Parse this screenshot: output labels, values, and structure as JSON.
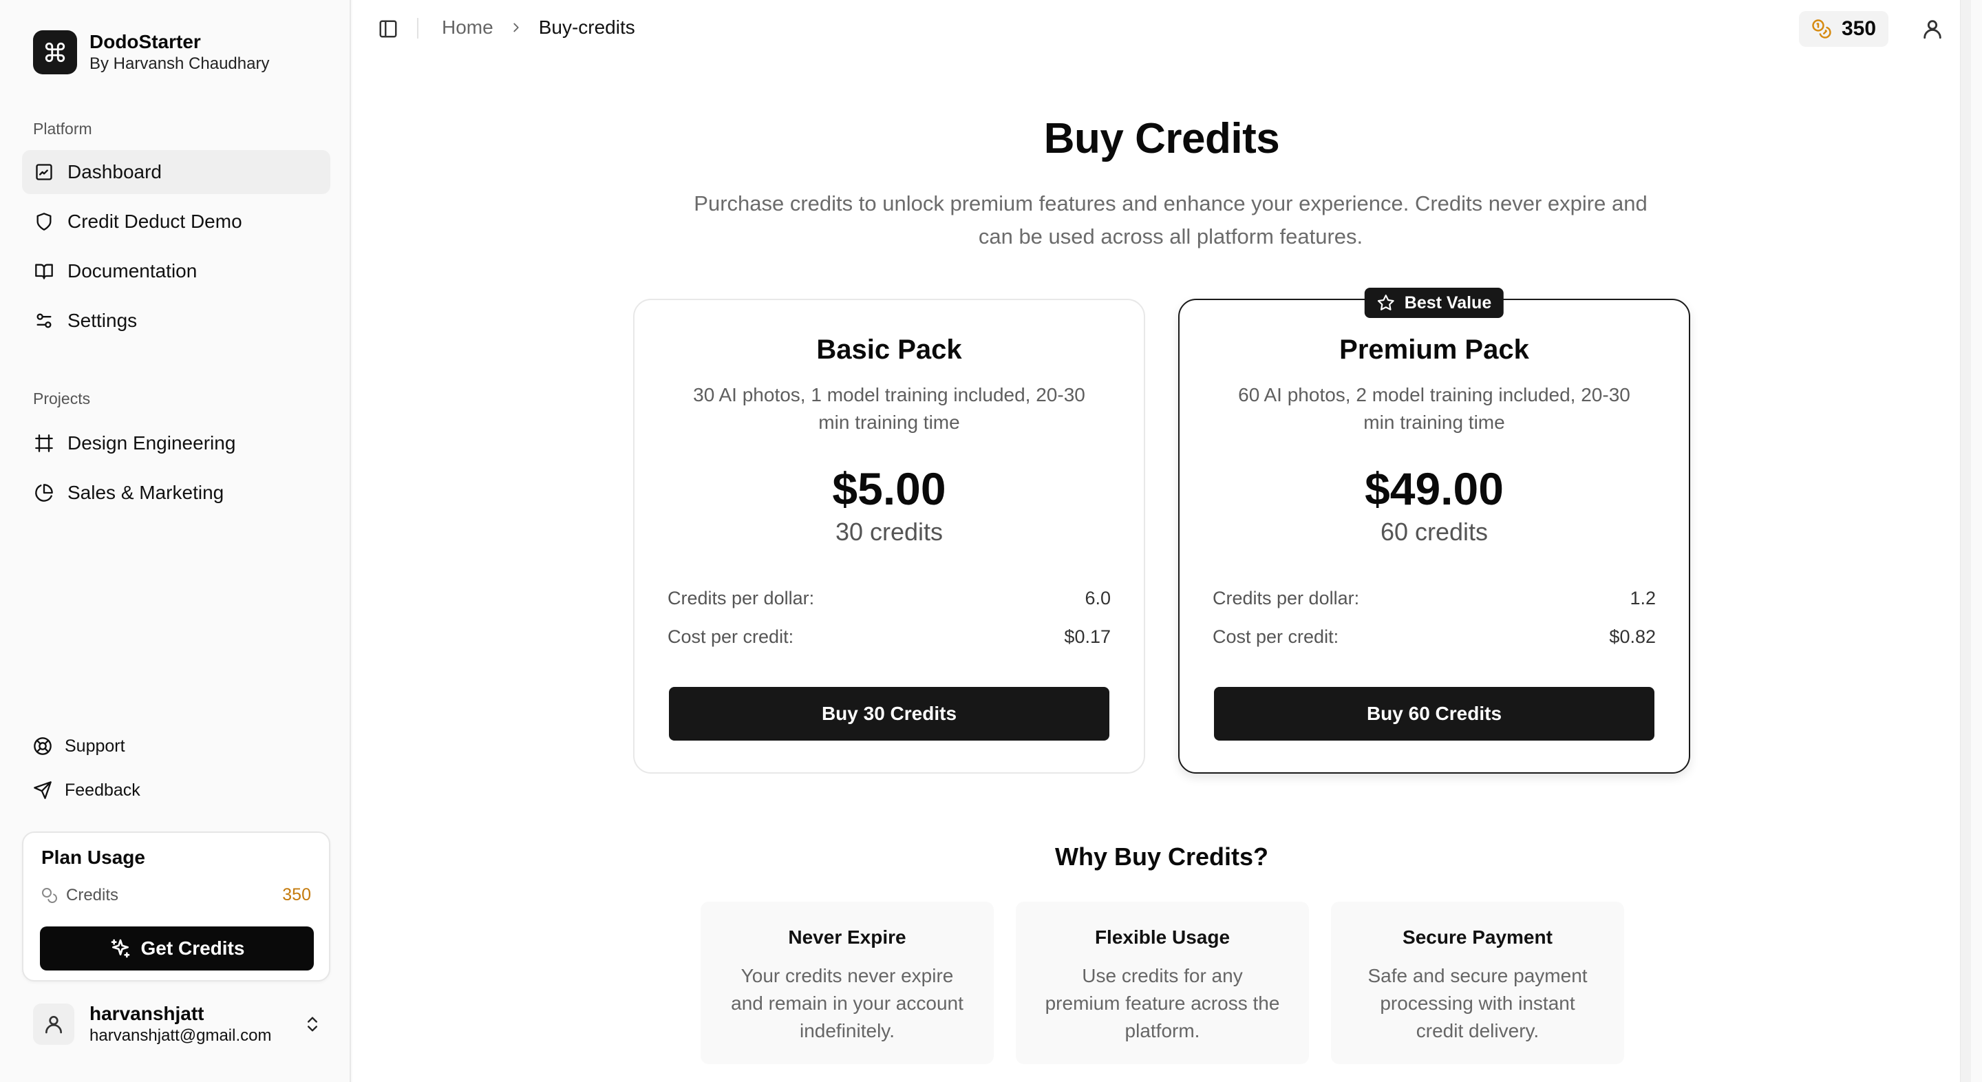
{
  "brand": {
    "name": "DodoStarter",
    "subtitle": "By Harvansh Chaudhary",
    "logo_icon": "command-icon"
  },
  "sidebar": {
    "platform_label": "Platform",
    "platform_items": [
      {
        "label": "Dashboard",
        "icon": "dashboard-icon",
        "active": true
      },
      {
        "label": "Credit Deduct Demo",
        "icon": "shield-icon"
      },
      {
        "label": "Documentation",
        "icon": "book-icon"
      },
      {
        "label": "Settings",
        "icon": "sliders-icon"
      }
    ],
    "projects_label": "Projects",
    "project_items": [
      {
        "label": "Design Engineering",
        "icon": "frame-icon"
      },
      {
        "label": "Sales & Marketing",
        "icon": "pie-chart-icon"
      }
    ],
    "secondary_items": [
      {
        "label": "Support",
        "icon": "lifebuoy-icon"
      },
      {
        "label": "Feedback",
        "icon": "send-icon"
      }
    ],
    "plan_usage": {
      "title": "Plan Usage",
      "credits_label": "Credits",
      "credits_value": "350",
      "credits_color": "#c47a0c",
      "button_label": "Get Credits"
    },
    "user": {
      "name": "harvanshjatt",
      "email": "harvanshjatt@gmail.com"
    }
  },
  "topbar": {
    "breadcrumb_home": "Home",
    "breadcrumb_current": "Buy-credits",
    "credits": "350"
  },
  "page": {
    "title": "Buy Credits",
    "subtitle": "Purchase credits to unlock premium features and enhance your experience. Credits never expire and can be used across all platform features."
  },
  "packs": [
    {
      "name": "Basic Pack",
      "description": "30 AI photos, 1 model training included, 20-30 min training time",
      "price": "$5.00",
      "credits": "30 credits",
      "credits_per_dollar_label": "Credits per dollar:",
      "credits_per_dollar": "6.0",
      "cost_per_credit_label": "Cost per credit:",
      "cost_per_credit": "$0.17",
      "button": "Buy 30 Credits"
    },
    {
      "name": "Premium Pack",
      "badge": "Best Value",
      "description": "60 AI photos, 2 model training included, 20-30 min training time",
      "price": "$49.00",
      "credits": "60 credits",
      "credits_per_dollar_label": "Credits per dollar:",
      "credits_per_dollar": "1.2",
      "cost_per_credit_label": "Cost per credit:",
      "cost_per_credit": "$0.82",
      "button": "Buy 60 Credits"
    }
  ],
  "why": {
    "title": "Why Buy Credits?",
    "cards": [
      {
        "title": "Never Expire",
        "text": "Your credits never expire and remain in your account indefinitely."
      },
      {
        "title": "Flexible Usage",
        "text": "Use credits for any premium feature across the platform."
      },
      {
        "title": "Secure Payment",
        "text": "Safe and secure payment processing with instant credit delivery."
      }
    ]
  }
}
